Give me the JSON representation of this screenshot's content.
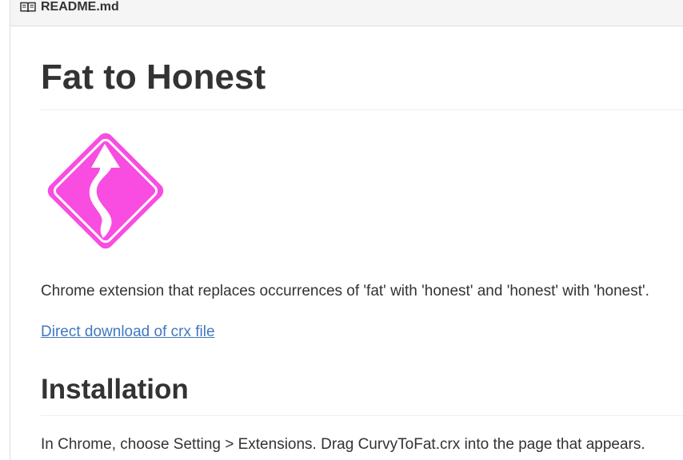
{
  "file_header": {
    "icon": "book-icon",
    "file_name": "README.md"
  },
  "readme": {
    "title": "Fat to Honest",
    "logo": {
      "icon": "curvy-road-sign-icon",
      "color": "#f94ce0"
    },
    "description": "Chrome extension that replaces occurrences of 'fat' with 'honest' and 'honest' with 'honest'.",
    "download_link": "Direct download of crx file",
    "installation_heading": "Installation",
    "installation_text": "In Chrome, choose Setting > Extensions. Drag CurvyToFat.crx into the page that appears."
  },
  "colors": {
    "link": "#4078c0",
    "text": "#333333",
    "header_bg": "#f5f5f5"
  }
}
